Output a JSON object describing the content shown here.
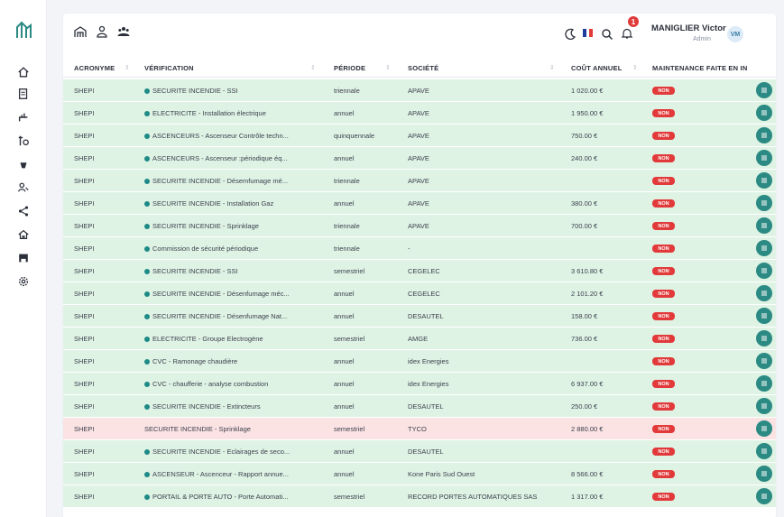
{
  "user": {
    "name": "MANIGLIER Victor",
    "role": "Admin",
    "initials": "VM",
    "notifications": "1"
  },
  "colors": {
    "accent": "#1e8a86",
    "row_ok": "#dff3e5",
    "row_alert": "#fbe2e3",
    "badge_red": "#e23a3a"
  },
  "sidebar": {
    "items": [
      {
        "icon": "home-icon"
      },
      {
        "icon": "document-icon"
      },
      {
        "icon": "plumbing-icon"
      },
      {
        "icon": "valve-icon"
      },
      {
        "icon": "fire-extinguisher-icon"
      },
      {
        "icon": "users-icon"
      },
      {
        "icon": "share-icon"
      },
      {
        "icon": "building-icon"
      },
      {
        "icon": "store-icon"
      },
      {
        "icon": "settings-icon"
      }
    ]
  },
  "topbar": {
    "icons": [
      "building-group-icon",
      "user-icon",
      "team-icon"
    ]
  },
  "table": {
    "headers": [
      "ACRONYME",
      "VÉRIFICATION",
      "PÉRIODE",
      "SOCIÉTÉ",
      "COÛT ANNUEL",
      "MAINTENANCE FAITE EN IN"
    ],
    "rows": [
      {
        "acronyme": "SHEPI",
        "verification": "SECURITE INCENDIE - SSI",
        "periode": "triennale",
        "societe": "APAVE",
        "cout": "1 020.00 €",
        "maintenance": "NON",
        "status": "ok",
        "dot": true
      },
      {
        "acronyme": "SHEPI",
        "verification": "ELECTRICITE - Installation électrique",
        "periode": "annuel",
        "societe": "APAVE",
        "cout": "1 950.00 €",
        "maintenance": "NON",
        "status": "ok",
        "dot": true
      },
      {
        "acronyme": "SHEPI",
        "verification": "ASCENCEURS - Ascenseur Contrôle techn...",
        "periode": "quinquennale",
        "societe": "APAVE",
        "cout": "750.00 €",
        "maintenance": "NON",
        "status": "ok",
        "dot": true
      },
      {
        "acronyme": "SHEPI",
        "verification": "ASCENCEURS - Ascenseur :périodique éq...",
        "periode": "annuel",
        "societe": "APAVE",
        "cout": "240.00 €",
        "maintenance": "NON",
        "status": "ok",
        "dot": true
      },
      {
        "acronyme": "SHEPI",
        "verification": "SECURITE INCENDIE - Désemfumage mé...",
        "periode": "triennale",
        "societe": "APAVE",
        "cout": "",
        "maintenance": "NON",
        "status": "ok",
        "dot": true
      },
      {
        "acronyme": "SHEPI",
        "verification": "SECURITE INCENDIE - Installation Gaz",
        "periode": "annuel",
        "societe": "APAVE",
        "cout": "380.00 €",
        "maintenance": "NON",
        "status": "ok",
        "dot": true
      },
      {
        "acronyme": "SHEPI",
        "verification": "SECURITE INCENDIE - Sprinklage",
        "periode": "triennale",
        "societe": "APAVE",
        "cout": "700.00 €",
        "maintenance": "NON",
        "status": "ok",
        "dot": true
      },
      {
        "acronyme": "SHEPI",
        "verification": "Commission de sécurité périodique",
        "periode": "triennale",
        "societe": "-",
        "cout": "",
        "maintenance": "NON",
        "status": "ok",
        "dot": true
      },
      {
        "acronyme": "SHEPI",
        "verification": "SECURITE INCENDIE - SSI",
        "periode": "semestriel",
        "societe": "CEGELEC",
        "cout": "3 610.80 €",
        "maintenance": "NON",
        "status": "ok",
        "dot": true
      },
      {
        "acronyme": "SHEPI",
        "verification": "SECURITE INCENDIE - Désenfumage méc...",
        "periode": "annuel",
        "societe": "CEGELEC",
        "cout": "2 101.20 €",
        "maintenance": "NON",
        "status": "ok",
        "dot": true
      },
      {
        "acronyme": "SHEPI",
        "verification": "SECURITE INCENDIE - Désenfumage Nat...",
        "periode": "annuel",
        "societe": "DESAUTEL",
        "cout": "158.00 €",
        "maintenance": "NON",
        "status": "ok",
        "dot": true
      },
      {
        "acronyme": "SHEPI",
        "verification": "ELECTRICITE - Groupe Electrogène",
        "periode": "semestriel",
        "societe": "AMGE",
        "cout": "736.00 €",
        "maintenance": "NON",
        "status": "ok",
        "dot": true
      },
      {
        "acronyme": "SHEPI",
        "verification": "CVC - Ramonage chaudière",
        "periode": "annuel",
        "societe": "idex Energies",
        "cout": "",
        "maintenance": "NON",
        "status": "ok",
        "dot": true
      },
      {
        "acronyme": "SHEPI",
        "verification": "CVC - chaufferie - analyse combustion",
        "periode": "annuel",
        "societe": "idex Energies",
        "cout": "6 937.00 €",
        "maintenance": "NON",
        "status": "ok",
        "dot": true
      },
      {
        "acronyme": "SHEPI",
        "verification": "SECURITE INCENDIE - Extincteurs",
        "periode": "annuel",
        "societe": "DESAUTEL",
        "cout": "250.00 €",
        "maintenance": "NON",
        "status": "ok",
        "dot": true
      },
      {
        "acronyme": "SHEPI",
        "verification": "SECURITE INCENDIE - Sprinklage",
        "periode": "semestriel",
        "societe": "TYCO",
        "cout": "2 880.00 €",
        "maintenance": "NON",
        "status": "alert",
        "dot": false
      },
      {
        "acronyme": "SHEPI",
        "verification": "SECURITE INCENDIE - Eclairages de seco...",
        "periode": "annuel",
        "societe": "DESAUTEL",
        "cout": "",
        "maintenance": "NON",
        "status": "ok",
        "dot": true
      },
      {
        "acronyme": "SHEPI",
        "verification": "ASCENSEUR - Ascenceur - Rapport annue...",
        "periode": "annuel",
        "societe": "Kone Paris Sud Ouest",
        "cout": "8 566.00 €",
        "maintenance": "NON",
        "status": "ok",
        "dot": true
      },
      {
        "acronyme": "SHEPI",
        "verification": "PORTAIL & PORTE AUTO - Porte Automati...",
        "periode": "semestriel",
        "societe": "RECORD PORTES AUTOMATIQUES SAS",
        "cout": "1 317.00 €",
        "maintenance": "NON",
        "status": "ok",
        "dot": true
      }
    ]
  }
}
